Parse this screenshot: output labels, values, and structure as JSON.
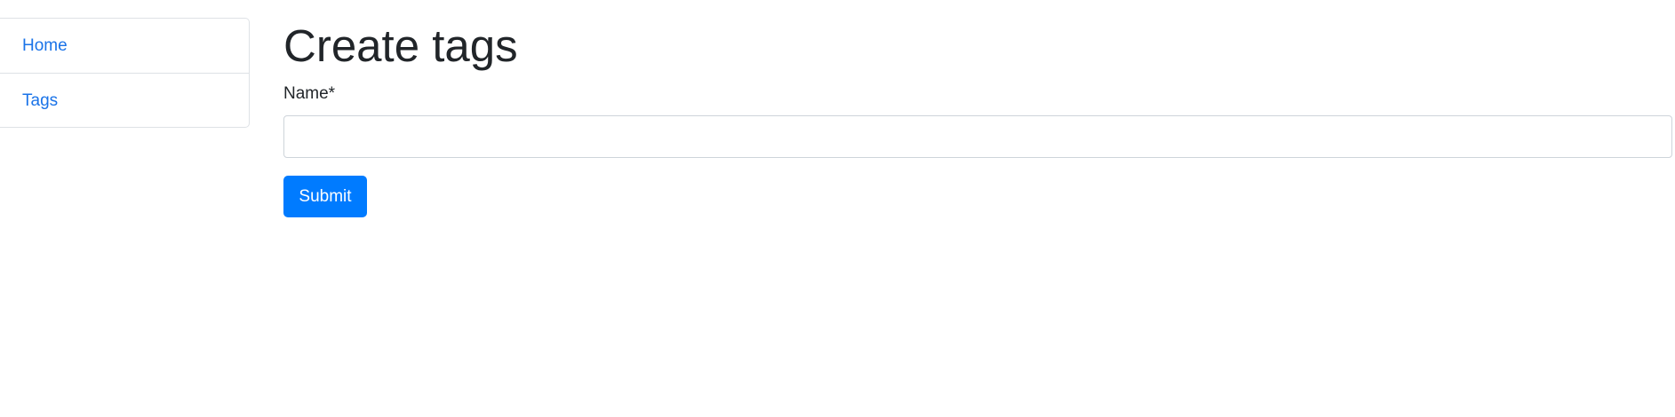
{
  "sidebar": {
    "items": [
      {
        "label": "Home"
      },
      {
        "label": "Tags"
      }
    ]
  },
  "main": {
    "title": "Create tags",
    "form": {
      "name_label": "Name*",
      "name_value": "",
      "name_placeholder": "",
      "submit_label": "Submit"
    }
  },
  "colors": {
    "link": "#1a73e8",
    "primary_button": "#007bff",
    "border": "#dee2e6"
  }
}
